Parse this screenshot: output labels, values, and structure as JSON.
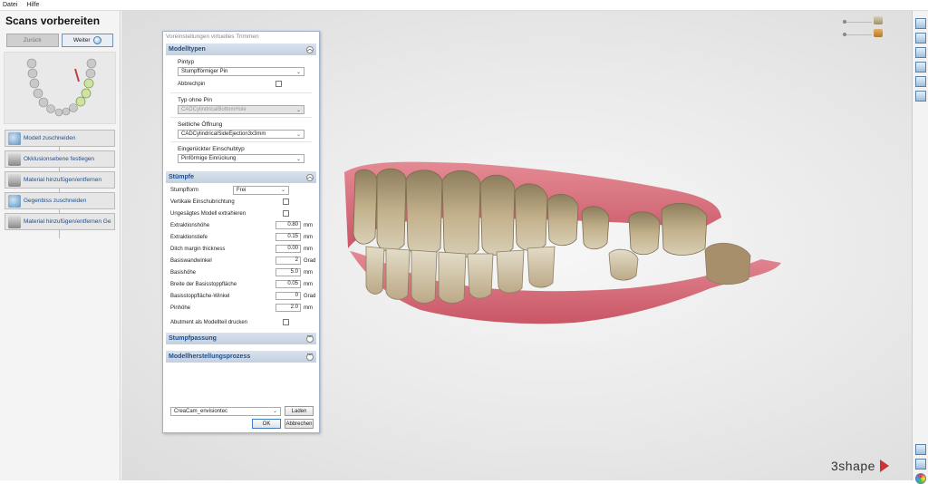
{
  "menu": [
    "Datei",
    "Hilfe"
  ],
  "left": {
    "title": "Scans vorbereiten",
    "back_label": "Zurück",
    "next_label": "Weiter",
    "steps": [
      {
        "label": "Modell zuschneiden",
        "icon": "model-cut-icon"
      },
      {
        "label": "Okklusionsebene festlegen",
        "icon": "occlusion-plane-icon"
      },
      {
        "label": "Material hinzufügen/entfernen",
        "icon": "material-icon"
      },
      {
        "label": "Gegenbiss zuschneiden",
        "icon": "antagonist-cut-icon"
      },
      {
        "label": "Material hinzufügen/entfernen Ge",
        "icon": "material-icon"
      }
    ]
  },
  "dialog": {
    "title": "Voreinstellungen virtuelles Trimmen",
    "modelltypen": {
      "header": "Modelltypen",
      "pintyp_label": "Pintyp",
      "pintyp_value": "Stumpfförmiger Pin",
      "abbrechpin_label": "Abbrechpin",
      "typ_ohne_pin_label": "Typ ohne Pin",
      "typ_ohne_pin_value": "CADCylindricalBottomHole",
      "seitliche_label": "Seitliche Öffnung",
      "seitliche_value": "CADCylindricalSideEjection3x3mm",
      "einschub_label": "Eingerückter Einschubtyp",
      "einschub_value": "Pinförmige Einrückung"
    },
    "stuempfe": {
      "header": "Stümpfe",
      "stumpfform_label": "Stumpfform",
      "stumpfform_value": "Frei",
      "vertikale_label": "Vertikale Einschubrichtung",
      "ungesaegtes_label": "Ungesägtes Modell extrahieren",
      "fields": [
        {
          "label": "Extraktionshöhe",
          "value": "0.80",
          "unit": "mm"
        },
        {
          "label": "Extraktionstiefe",
          "value": "0.15",
          "unit": "mm"
        },
        {
          "label": "Ditch margin thickness",
          "value": "0.00",
          "unit": "mm"
        },
        {
          "label": "Basiswandwinkel",
          "value": "2",
          "unit": "Grad"
        },
        {
          "label": "Basishöhe",
          "value": "5.0",
          "unit": "mm"
        },
        {
          "label": "Breite der Basisstoppfläche",
          "value": "0.05",
          "unit": "mm"
        },
        {
          "label": "Basisstoppfläche-Winkel",
          "value": "0",
          "unit": "Grad"
        },
        {
          "label": "Pinhöhe",
          "value": "2.0",
          "unit": "mm"
        }
      ],
      "abutment_label": "Abutment als Modellteil drucken"
    },
    "stumpfpassung_header": "Stumpfpassung",
    "modellherstellung_header": "Modellherstellungsprozess",
    "process_value": "CreaCam_envisiontec",
    "laden_label": "Laden",
    "ok_label": "OK",
    "abbrechen_label": "Abbrechen"
  },
  "brand": "3shape",
  "colors": {
    "accent": "#1e4e8c",
    "section": "#c4d0df",
    "gum": "#d96a78",
    "tooth": "#b9a27a"
  }
}
